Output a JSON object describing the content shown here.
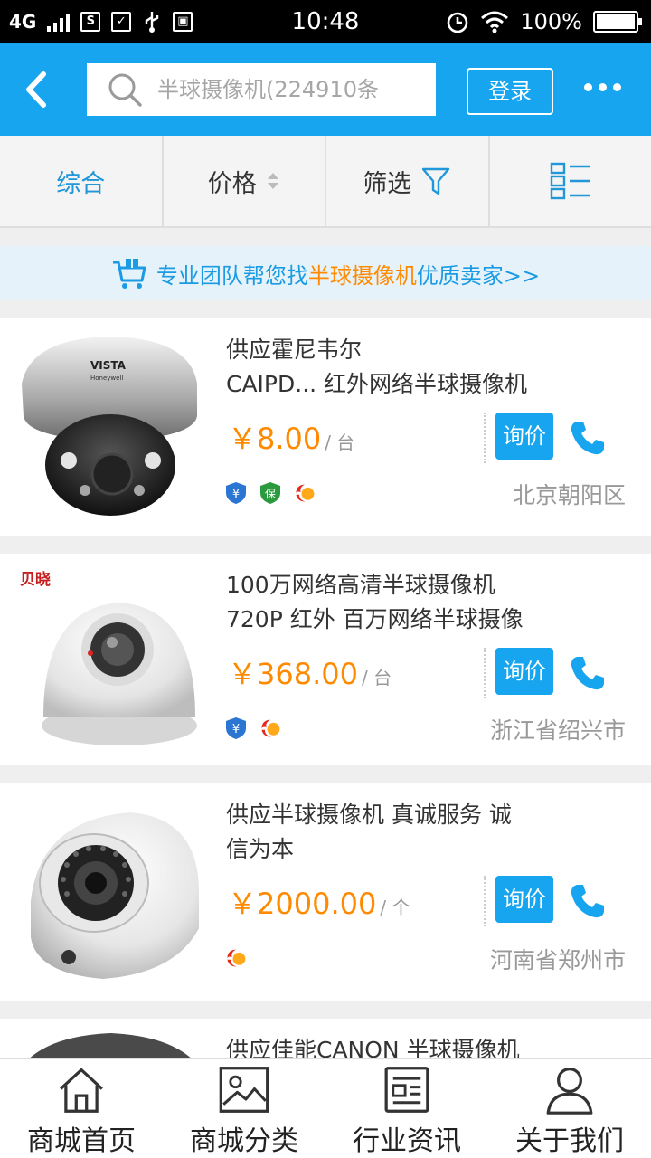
{
  "status_bar": {
    "network": "4G",
    "time": "10:48",
    "battery": "100%"
  },
  "header": {
    "search_placeholder": "半球摄像机(224910条",
    "login_label": "登录"
  },
  "sort_tabs": [
    {
      "label": "综合"
    },
    {
      "label": "价格"
    },
    {
      "label": "筛选"
    }
  ],
  "banner": {
    "prefix": "专业团队帮您找",
    "keyword": "半球摄像机",
    "suffix": "优质卖家>>"
  },
  "products": [
    {
      "title_line1": "供应霍尼韦尔",
      "title_line2": "CAIPD... 红外网络半球摄像机",
      "price": "￥8.00",
      "unit": "/ 台",
      "ask_label": "询价",
      "location": "北京朝阳区",
      "badges": [
        "yen-shield-icon",
        "bao-shield-icon",
        "flame-icon"
      ],
      "image_brand": "VISTA",
      "image_subbrand": "Honeywell"
    },
    {
      "title_line1": "100万网络高清半球摄像机",
      "title_line2": "720P 红外 百万网络半球摄像",
      "price": "￥368.00",
      "unit": "/ 台",
      "ask_label": "询价",
      "location": "浙江省绍兴市",
      "badges": [
        "yen-shield-icon",
        "flame-icon"
      ],
      "image_brand": "贝晓"
    },
    {
      "title_line1": "供应半球摄像机 真诚服务 诚",
      "title_line2": "信为本",
      "price": "￥2000.00",
      "unit": "/ 个",
      "ask_label": "询价",
      "location": "河南省郑州市",
      "badges": [
        "flame-icon"
      ]
    },
    {
      "title_line1": "供应佳能CANON 半球摄像机"
    }
  ],
  "bottom_nav": [
    {
      "label": "商城首页",
      "icon": "home-icon"
    },
    {
      "label": "商城分类",
      "icon": "image-icon"
    },
    {
      "label": "行业资讯",
      "icon": "news-icon"
    },
    {
      "label": "关于我们",
      "icon": "person-icon"
    }
  ],
  "colors": {
    "brand_blue": "#16a5ee",
    "price_orange": "#ff8a00",
    "active_tab": "#2196d8"
  }
}
